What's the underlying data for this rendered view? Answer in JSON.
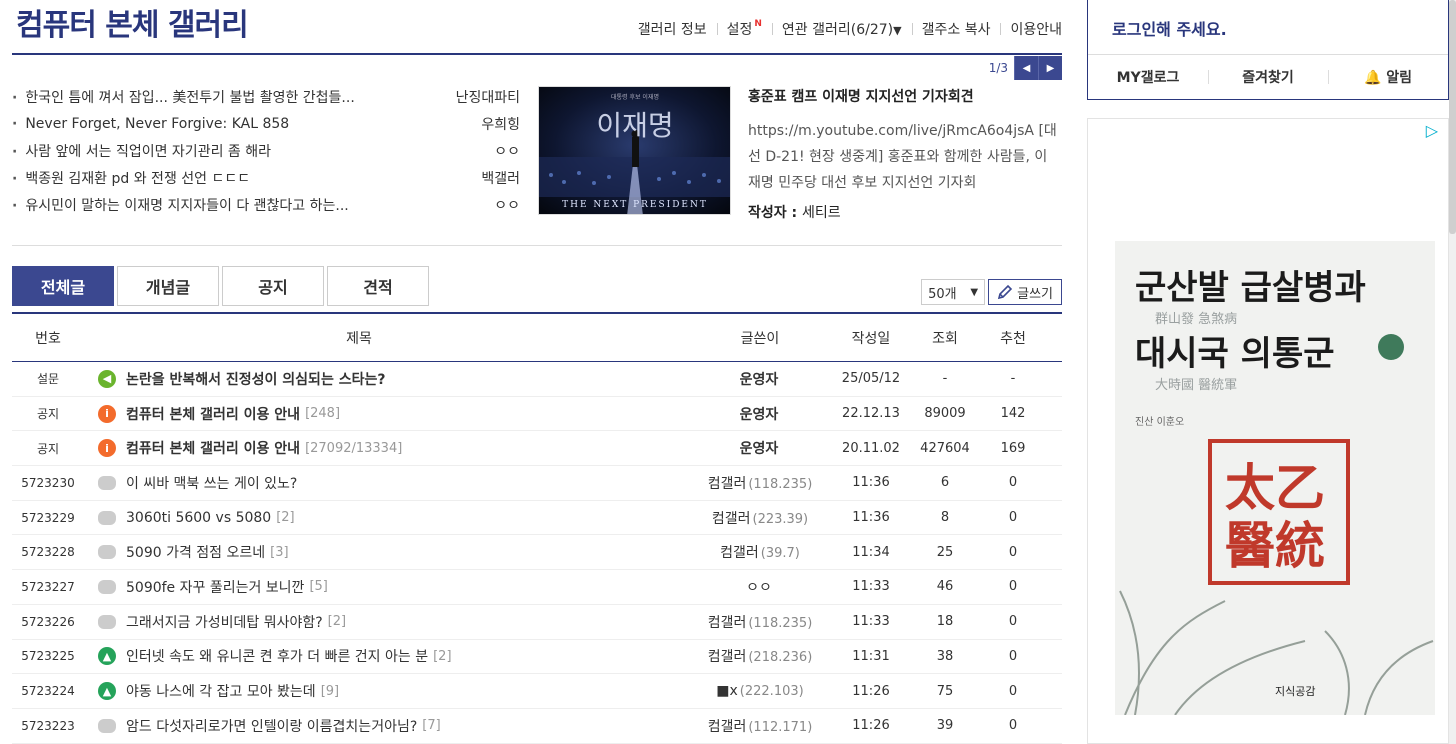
{
  "gallery": {
    "title": "컴퓨터 본체 갤러리"
  },
  "top_menu": {
    "info": "갤러리 정보",
    "settings": "설정",
    "settings_badge": "N",
    "related": "연관 갤러리(6/27)",
    "copy_address": "갤주소 복사",
    "guide": "이용안내"
  },
  "issue": {
    "page": "1/3",
    "items": [
      {
        "title": "한국인 틈에 껴서 잠입... 美전투기 불법 촬영한 간첩들...",
        "writer": "난징대파티"
      },
      {
        "title": "Never Forget, Never Forgive: KAL 858",
        "writer": "우희힝"
      },
      {
        "title": "사람 앞에 서는 직업이면 자기관리 좀 해라",
        "writer": "ㅇㅇ"
      },
      {
        "title": "백종원 김재환 pd 와 전쟁 선언 ㄷㄷㄷ",
        "writer": "백갤러"
      },
      {
        "title": "유시민이 말하는 이재명 지지자들이 다 괜찮다고 하는...",
        "writer": "ㅇㅇ"
      }
    ],
    "featured": {
      "thumb_title": "이재명",
      "thumb_subtitle": "THE NEXT PRESIDENT",
      "thumb_top": "대통령 후보 이재명",
      "headline": "홍준표 캠프 이재명 지지선언 기자회견",
      "body": "https://m.youtube.com/live/jRmcA6o4jsA [대선 D-21! 현장 생중계] 홍준표와 함께한 사람들, 이재명 민주당 대선 후보 지지선언 기자회",
      "author_label": "작성자",
      "author": "세티르"
    }
  },
  "tabs": [
    "전체글",
    "개념글",
    "공지",
    "견적"
  ],
  "list_tools": {
    "per_page": "50개",
    "write": "글쓰기"
  },
  "board": {
    "headers": {
      "num": "번호",
      "title": "제목",
      "writer": "글쓴이",
      "date": "작성일",
      "views": "조회",
      "recommend": "추천"
    },
    "rows": [
      {
        "num": "설문",
        "icon": "survey",
        "title": "논란을 반복해서 진정성이 의심되는 스타는?",
        "reply": "",
        "writer": "운영자",
        "ip": "",
        "date": "25/05/12",
        "views": "-",
        "rec": "-",
        "notice": true
      },
      {
        "num": "공지",
        "icon": "info",
        "title": "컴퓨터 본체 갤러리 이용 안내",
        "reply": "[248]",
        "writer": "운영자",
        "ip": "",
        "date": "22.12.13",
        "views": "89009",
        "rec": "142",
        "notice": true
      },
      {
        "num": "공지",
        "icon": "info",
        "title": "컴퓨터 본체 갤러리 이용 안내",
        "reply": "[27092/13334]",
        "writer": "운영자",
        "ip": "",
        "date": "20.11.02",
        "views": "427604",
        "rec": "169",
        "notice": true
      },
      {
        "num": "5723230",
        "icon": "speech",
        "title": "이 씨바 맥북 쓰는 게이 있노?",
        "reply": "",
        "writer": "컴갤러",
        "ip": "(118.235)",
        "date": "11:36",
        "views": "6",
        "rec": "0",
        "notice": false
      },
      {
        "num": "5723229",
        "icon": "speech",
        "title": "3060ti 5600 vs 5080",
        "reply": "[2]",
        "writer": "컴갤러",
        "ip": "(223.39)",
        "date": "11:36",
        "views": "8",
        "rec": "0",
        "notice": false
      },
      {
        "num": "5723228",
        "icon": "speech",
        "title": "5090 가격 점점 오르네",
        "reply": "[3]",
        "writer": "컴갤러",
        "ip": "(39.7)",
        "date": "11:34",
        "views": "25",
        "rec": "0",
        "notice": false
      },
      {
        "num": "5723227",
        "icon": "speech",
        "title": "5090fe 자꾸 풀리는거 보니깐",
        "reply": "[5]",
        "writer": "ㅇㅇ",
        "ip": "",
        "date": "11:33",
        "views": "46",
        "rec": "0",
        "notice": false
      },
      {
        "num": "5723226",
        "icon": "speech",
        "title": "그래서지금 가성비데탑 뭐사야함?",
        "reply": "[2]",
        "writer": "컴갤러",
        "ip": "(118.235)",
        "date": "11:33",
        "views": "18",
        "rec": "0",
        "notice": false
      },
      {
        "num": "5723225",
        "icon": "img",
        "title": "인터넷 속도 왜 유니콘 켠 후가 더 빠른 건지 아는 분",
        "reply": "[2]",
        "writer": "컴갤러",
        "ip": "(218.236)",
        "date": "11:31",
        "views": "38",
        "rec": "0",
        "notice": false
      },
      {
        "num": "5723224",
        "icon": "img",
        "title": "야동 나스에 각 잡고 모아 봤는데",
        "reply": "[9]",
        "writer": "■x",
        "ip": "(222.103)",
        "date": "11:26",
        "views": "75",
        "rec": "0",
        "notice": false
      },
      {
        "num": "5723223",
        "icon": "speech",
        "title": "암드 다섯자리로가면 인텔이랑 이름겹치는거아님?",
        "reply": "[7]",
        "writer": "컴갤러",
        "ip": "(112.171)",
        "date": "11:26",
        "views": "39",
        "rec": "0",
        "notice": false
      }
    ]
  },
  "side": {
    "login_prompt": "로그인해 주세요.",
    "menu": [
      "MY갤로그",
      "즐겨찾기",
      "알림"
    ]
  },
  "ad": {
    "book_line1": "군산발  급살병과",
    "book_hanja1": "群山發   急煞病",
    "book_line2": "대시국  의통군",
    "book_hanja2": "大時國   醫統軍",
    "author": "진산 이훈오",
    "seal_text": "太乙醫統",
    "publisher": "지식공감"
  }
}
